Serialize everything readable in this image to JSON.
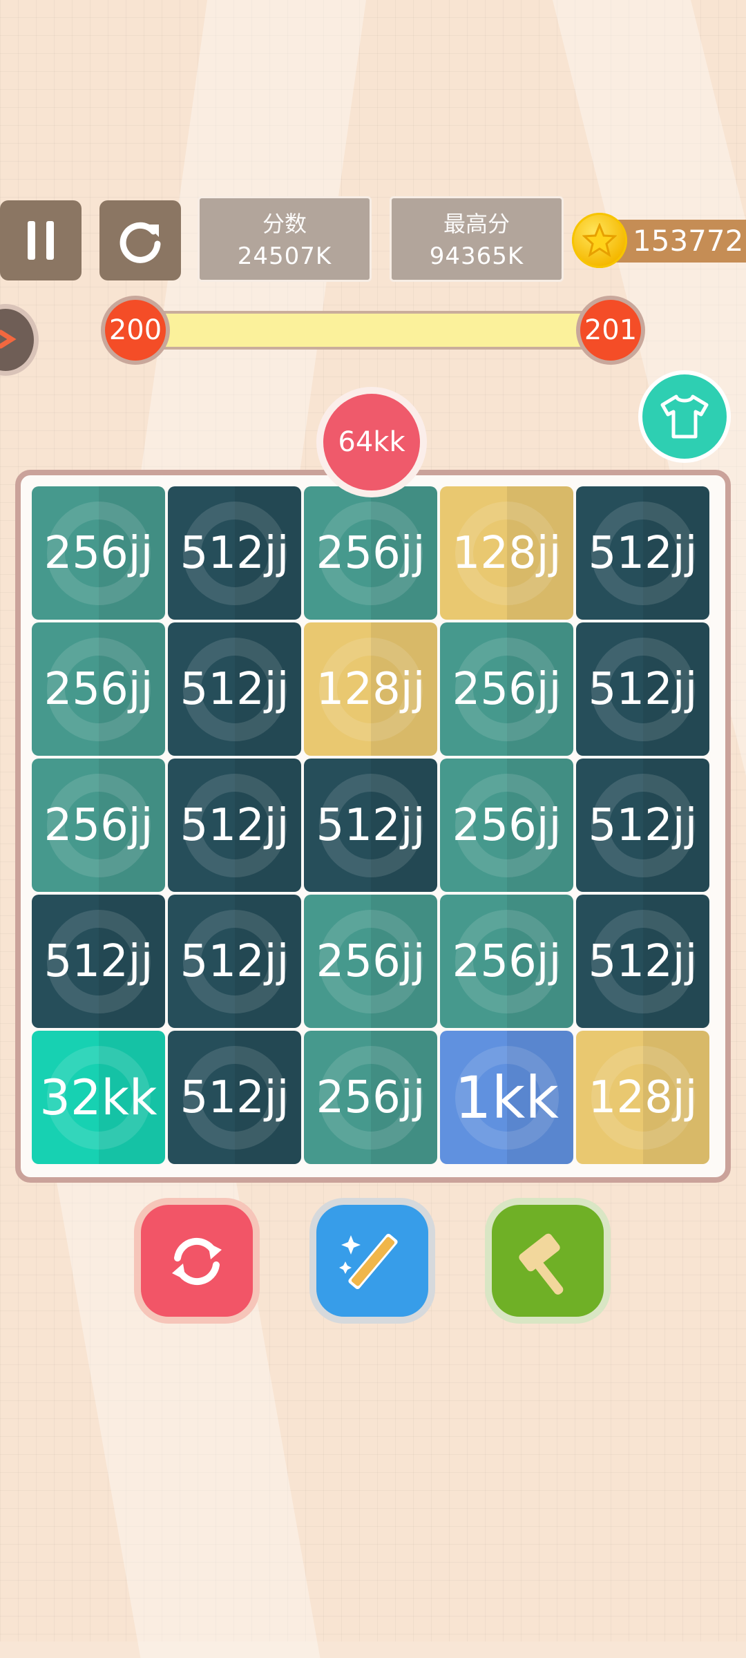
{
  "topbar": {
    "pause_icon": "pause-icon",
    "restart_icon": "restart-icon",
    "score_label": "分数",
    "score_value": "24507K",
    "best_label": "最高分",
    "best_value": "94365K",
    "coins": "153772",
    "coin_icon": "star-coin-icon"
  },
  "level": {
    "current": "200",
    "next": "201",
    "progress": 1.0
  },
  "next_tile": "64kk",
  "board": {
    "rows": [
      [
        "256jj",
        "512jj",
        "256jj",
        "128jj",
        "512jj"
      ],
      [
        "256jj",
        "512jj",
        "128jj",
        "256jj",
        "512jj"
      ],
      [
        "256jj",
        "512jj",
        "512jj",
        "256jj",
        "512jj"
      ],
      [
        "512jj",
        "512jj",
        "256jj",
        "256jj",
        "512jj"
      ],
      [
        "32kk",
        "512jj",
        "256jj",
        "1kk",
        "128jj"
      ]
    ]
  },
  "colors": {
    "256jj": "#46998d",
    "512jj": "#264e5a",
    "128jj": "#e9c870",
    "32kk": "#17d1b2",
    "1kk": "#6091df",
    "next_tile": "#ef5a6b"
  },
  "powerups": [
    "shuffle-icon",
    "magic-wand-icon",
    "hammer-icon"
  ]
}
